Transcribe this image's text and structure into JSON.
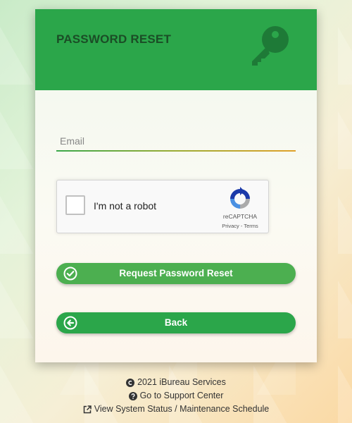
{
  "header": {
    "title": "PASSWORD RESET",
    "icon": "key-icon",
    "color": "#2ba64a"
  },
  "form": {
    "email_placeholder": "Email",
    "email_value": ""
  },
  "captcha": {
    "label": "I'm not a robot",
    "brand": "reCAPTCHA",
    "links": "Privacy - Terms",
    "checked": false
  },
  "buttons": {
    "reset_label": "Request Password Reset",
    "reset_icon": "check-circle-icon",
    "back_label": "Back",
    "back_icon": "arrow-left-circle-icon"
  },
  "footer": {
    "copyright": "2021 iBureau Services",
    "support": "Go to Support Center",
    "status": "View System Status / Maintenance Schedule"
  }
}
